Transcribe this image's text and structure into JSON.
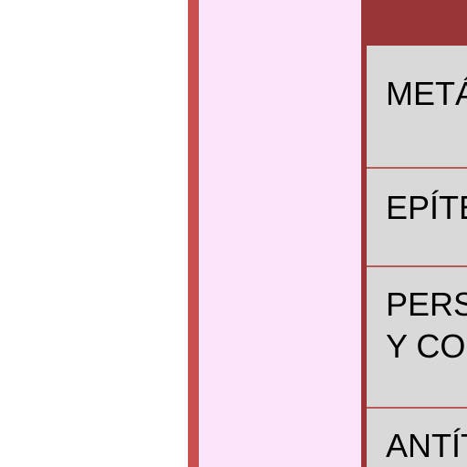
{
  "table": {
    "rows": [
      {
        "lines": [
          "METÁ"
        ]
      },
      {
        "lines": [
          "EPÍTE"
        ]
      },
      {
        "lines": [
          "PERSO",
          "Y COS"
        ]
      },
      {
        "lines": [
          "ANTÍT"
        ]
      }
    ]
  },
  "colors": {
    "strip": "#c8504f",
    "panel": "#fce4fb",
    "header": "#9a3535",
    "cell": "#d9d9d9",
    "divider": "#b85a58"
  }
}
